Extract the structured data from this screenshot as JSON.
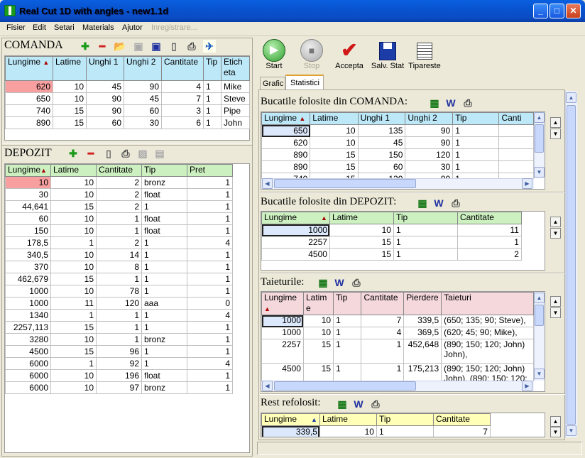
{
  "window": {
    "title": "Real Cut 1D with angles - new1.1d"
  },
  "menu": [
    "Fisier",
    "Edit",
    "Setari",
    "Materials",
    "Ajutor",
    "Inregistrare..."
  ],
  "comanda": {
    "title": "COMANDA",
    "headers": [
      "Lungime",
      "Latime",
      "Unghi 1",
      "Unghi 2",
      "Cantitate",
      "Tip",
      "Eticheta"
    ],
    "rows": [
      [
        "620",
        "10",
        "45",
        "90",
        "4",
        "1",
        "Mike"
      ],
      [
        "650",
        "10",
        "90",
        "45",
        "7",
        "1",
        "Steve"
      ],
      [
        "740",
        "15",
        "90",
        "60",
        "3",
        "1",
        "Pipe"
      ],
      [
        "890",
        "15",
        "60",
        "30",
        "6",
        "1",
        "John"
      ]
    ]
  },
  "depozit": {
    "title": "DEPOZIT",
    "headers": [
      "Lungime",
      "Latime",
      "Cantitate",
      "Tip",
      "Pret"
    ],
    "rows": [
      [
        "10",
        "10",
        "2",
        "bronz",
        "1"
      ],
      [
        "30",
        "10",
        "2",
        "float",
        "1"
      ],
      [
        "44,641",
        "15",
        "2",
        "1",
        "1"
      ],
      [
        "60",
        "10",
        "1",
        "float",
        "1"
      ],
      [
        "150",
        "10",
        "1",
        "float",
        "1"
      ],
      [
        "178,5",
        "1",
        "2",
        "1",
        "4"
      ],
      [
        "340,5",
        "10",
        "14",
        "1",
        "1"
      ],
      [
        "370",
        "10",
        "8",
        "1",
        "1"
      ],
      [
        "462,679",
        "15",
        "1",
        "1",
        "1"
      ],
      [
        "1000",
        "10",
        "78",
        "1",
        "1"
      ],
      [
        "1000",
        "11",
        "120",
        "aaa",
        "0"
      ],
      [
        "1340",
        "1",
        "1",
        "1",
        "4"
      ],
      [
        "2257,113",
        "15",
        "1",
        "1",
        "1"
      ],
      [
        "3280",
        "10",
        "1",
        "bronz",
        "1"
      ],
      [
        "4500",
        "15",
        "96",
        "1",
        "1"
      ],
      [
        "6000",
        "1",
        "92",
        "1",
        "4"
      ],
      [
        "6000",
        "10",
        "196",
        "float",
        "1"
      ],
      [
        "6000",
        "10",
        "97",
        "bronz",
        "1"
      ]
    ]
  },
  "toolbar": {
    "start": "Start",
    "stop": "Stop",
    "accept": "Accepta",
    "save": "Salv. Stat",
    "print": "Tipareste"
  },
  "tabs": [
    "Grafic",
    "Statistici"
  ],
  "comanda_used": {
    "title": "Bucatile folosite din COMANDA:",
    "headers": [
      "Lungime",
      "Latime",
      "Unghi 1",
      "Unghi 2",
      "Tip",
      "Canti"
    ],
    "rows": [
      [
        "650",
        "10",
        "135",
        "90",
        "1"
      ],
      [
        "620",
        "10",
        "45",
        "90",
        "1"
      ],
      [
        "890",
        "15",
        "150",
        "120",
        "1"
      ],
      [
        "890",
        "15",
        "60",
        "30",
        "1"
      ],
      [
        "740",
        "15",
        "120",
        "90",
        "1"
      ]
    ]
  },
  "depozit_used": {
    "title": "Bucatile folosite din DEPOZIT:",
    "headers": [
      "Lungime",
      "Latime",
      "Tip",
      "Cantitate"
    ],
    "rows": [
      [
        "1000",
        "10",
        "1",
        "11"
      ],
      [
        "2257",
        "15",
        "1",
        "1"
      ],
      [
        "4500",
        "15",
        "1",
        "2"
      ]
    ]
  },
  "cuts": {
    "title": "Taieturile:",
    "headers": [
      "Lungime",
      "Latime",
      "Tip",
      "Cantitate",
      "Pierdere",
      "Taieturi"
    ],
    "rows": [
      [
        "1000",
        "10",
        "1",
        "7",
        "339,5",
        "(650; 135; 90; Steve),"
      ],
      [
        "1000",
        "10",
        "1",
        "4",
        "369,5",
        "(620; 45; 90; Mike),"
      ],
      [
        "2257",
        "15",
        "1",
        "1",
        "452,648",
        "(890; 150; 120; John)",
        "John),"
      ],
      [
        "4500",
        "15",
        "1",
        "1",
        "175,213",
        "(890; 150; 120; John)",
        "John), (890; 150; 120;"
      ]
    ]
  },
  "rest": {
    "title": "Rest refolosit:",
    "headers": [
      "Lungime",
      "Latime",
      "Tip",
      "Cantitate"
    ],
    "rows": [
      [
        "339,5",
        "10",
        "1",
        "7"
      ]
    ]
  }
}
